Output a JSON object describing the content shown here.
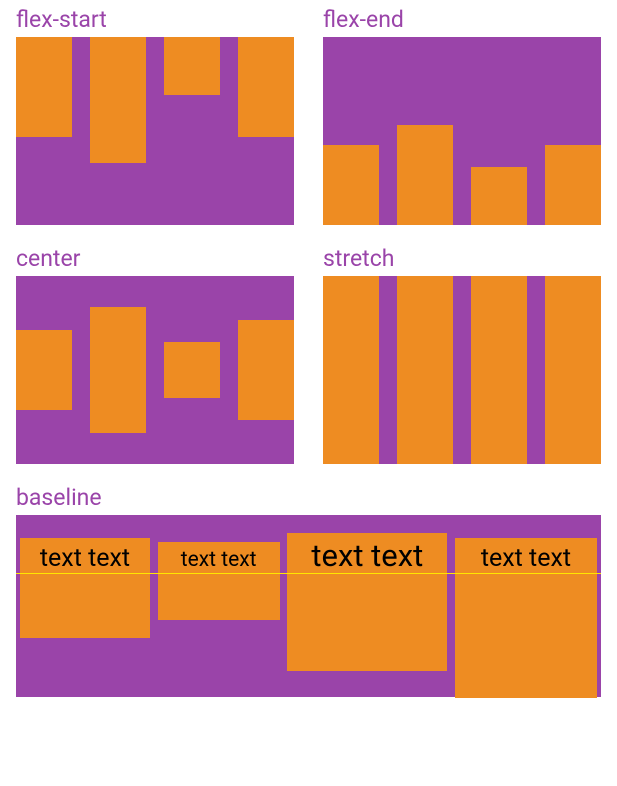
{
  "labels": {
    "flex_start": "flex-start",
    "flex_end": "flex-end",
    "center": "center",
    "stretch": "stretch",
    "baseline": "baseline"
  },
  "baseline_items": {
    "item1": "text text",
    "item2": "text text",
    "item3": "text text",
    "item4": "text text"
  },
  "colors": {
    "container": "#9a44a9",
    "item": "#ee8c22",
    "label": "#9a44a9",
    "baseline_line": "#ffe600"
  }
}
